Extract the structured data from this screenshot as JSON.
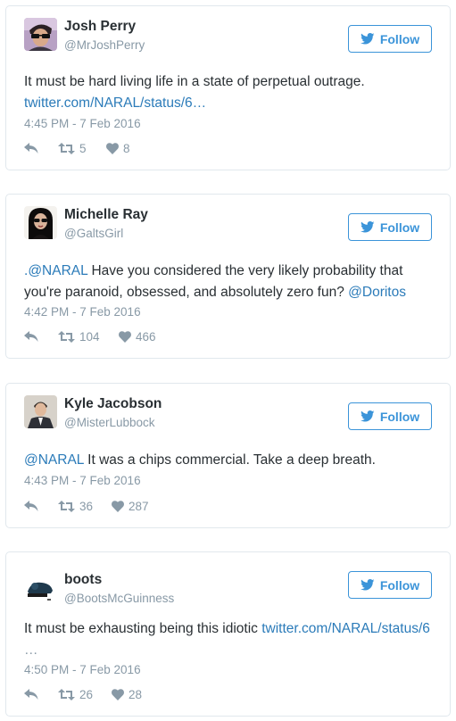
{
  "follow_label": "Follow",
  "colors": {
    "accent": "#3b94d9",
    "link": "#2b7bb9",
    "muted": "#8899a6",
    "text": "#292f33",
    "border": "#e1e8ed"
  },
  "tweets": [
    {
      "name": "Josh Perry",
      "handle": "@MrJoshPerry",
      "text": "It must be hard living life in a state of perpetual outrage.",
      "link": "twitter.com/NARAL/status/6…",
      "time": "4:45 PM - 7 Feb 2016",
      "retweets": "5",
      "likes": "8"
    },
    {
      "name": "Michelle Ray",
      "handle": "@GaltsGirl",
      "text_prefix": ".",
      "mention1": "@NARAL",
      "text_body": " Have you considered the very likely probability that you're paranoid, obsessed, and absolutely zero fun? ",
      "mention2": "@Doritos",
      "time": "4:42 PM - 7 Feb 2016",
      "retweets": "104",
      "likes": "466"
    },
    {
      "name": "Kyle Jacobson",
      "handle": "@MisterLubbock",
      "mention": "@NARAL",
      "text": " It was a chips commercial. Take a deep breath.",
      "time": "4:43 PM - 7 Feb 2016",
      "retweets": "36",
      "likes": "287"
    },
    {
      "name": "boots",
      "handle": "@BootsMcGuinness",
      "text": "It must be exhausting being this idiotic ",
      "link": "twitter.com/NARAL/status/6",
      "ellipsis": "…",
      "time": "4:50 PM - 7 Feb 2016",
      "retweets": "26",
      "likes": "28"
    }
  ]
}
